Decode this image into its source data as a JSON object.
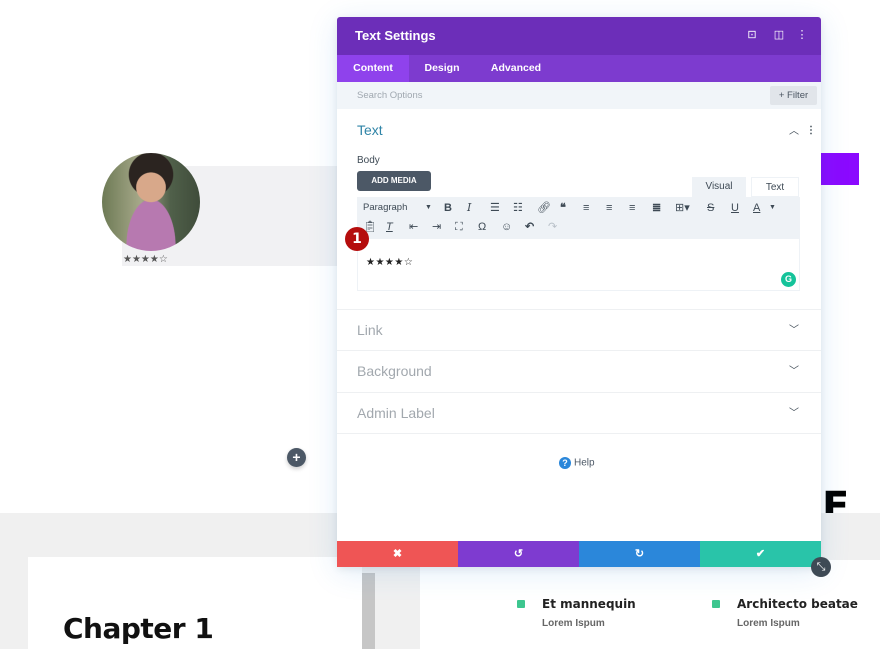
{
  "background": {
    "avatar_rating": "★★★★☆",
    "add_button_symbol": "+",
    "chapter_title": "Chapter 1",
    "big_letter": "E",
    "features": [
      {
        "title": "Et mannequin",
        "subtitle": "Lorem Ispum"
      },
      {
        "title": "Architecto beatae",
        "subtitle": "Lorem Ispum"
      }
    ],
    "accent_purple": "#8b09ff",
    "feature_square_color": "#3dc68f"
  },
  "modal": {
    "title": "Text Settings",
    "header_icons": [
      "fullscreen-icon",
      "split-view-icon",
      "more-options-icon"
    ],
    "header_icon_glyphs": [
      "⊡",
      "◫",
      "⋮"
    ],
    "tabs": [
      {
        "label": "Content",
        "active": true
      },
      {
        "label": "Design",
        "active": false
      },
      {
        "label": "Advanced",
        "active": false
      }
    ],
    "search": {
      "placeholder": "Search Options",
      "value": ""
    },
    "filter_label": "+ Filter",
    "sections": {
      "text": {
        "title": "Text",
        "expanded": true,
        "body_label": "Body",
        "add_media_label": "ADD MEDIA",
        "mode_tabs": [
          "Visual",
          "Text"
        ],
        "active_mode": "Visual",
        "toolbar": {
          "format_select": "Paragraph",
          "row1": [
            "bold",
            "italic",
            "bullet-list",
            "numbered-list",
            "link",
            "blockquote",
            "align-left",
            "align-center",
            "align-right",
            "justify",
            "table",
            "strikethrough",
            "underline",
            "text-color"
          ],
          "row2": [
            "paste-as-text",
            "clear-formatting",
            "outdent",
            "indent",
            "fullscreen",
            "special-character",
            "emoji",
            "undo",
            "redo"
          ]
        },
        "editor_content": "★★★★☆",
        "step_badge": "1"
      },
      "link": {
        "title": "Link",
        "expanded": false
      },
      "background": {
        "title": "Background",
        "expanded": false
      },
      "admin_label": {
        "title": "Admin Label",
        "expanded": false
      }
    },
    "help_label": "Help",
    "footer": {
      "cancel_glyph": "✖",
      "undo_glyph": "↺",
      "redo_glyph": "↻",
      "save_glyph": "✔",
      "colors": {
        "cancel": "#ef5555",
        "undo": "#7e3bd0",
        "redo": "#2b87da",
        "save": "#29c4a9"
      }
    },
    "colors": {
      "header": "#6c2eb9",
      "tabs": "#7d3bcf",
      "active_tab": "#8f42ec",
      "section_open_title": "#2f84a7"
    }
  }
}
